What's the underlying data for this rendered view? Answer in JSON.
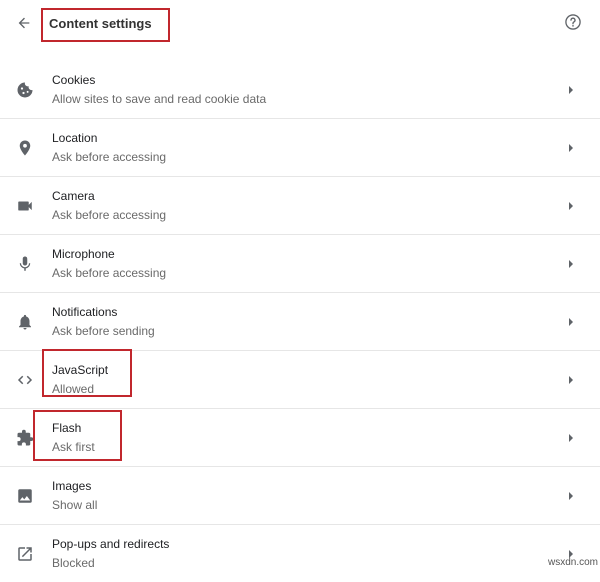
{
  "header": {
    "title": "Content settings",
    "back_icon": "back-arrow-icon",
    "help_icon": "help-circle-icon"
  },
  "settings": [
    {
      "label": "Cookies",
      "sublabel": "Allow sites to save and read cookie data",
      "icon": "cookie-icon"
    },
    {
      "label": "Location",
      "sublabel": "Ask before accessing",
      "icon": "location-pin-icon"
    },
    {
      "label": "Camera",
      "sublabel": "Ask before accessing",
      "icon": "camera-icon"
    },
    {
      "label": "Microphone",
      "sublabel": "Ask before accessing",
      "icon": "microphone-icon"
    },
    {
      "label": "Notifications",
      "sublabel": "Ask before sending",
      "icon": "bell-icon"
    },
    {
      "label": "JavaScript",
      "sublabel": "Allowed",
      "icon": "code-icon"
    },
    {
      "label": "Flash",
      "sublabel": "Ask first",
      "icon": "puzzle-piece-icon"
    },
    {
      "label": "Images",
      "sublabel": "Show all",
      "icon": "image-icon"
    },
    {
      "label": "Pop-ups and redirects",
      "sublabel": "Blocked",
      "icon": "external-link-icon"
    }
  ],
  "highlight_color": "#c1272d",
  "watermark": "wsxdn.com"
}
